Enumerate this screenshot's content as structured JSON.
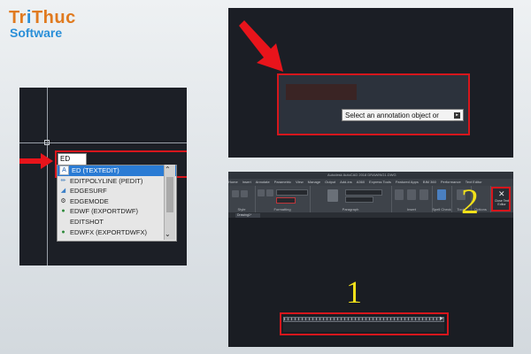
{
  "logo": {
    "line1a": "Tr",
    "line1b": "i",
    "line1c": "Thuc",
    "line2": "Software"
  },
  "panel1": {
    "command_input": "ED",
    "suggestions": [
      {
        "label": "ED (TEXTEDIT)",
        "icon": "text-edit-icon",
        "selected": true
      },
      {
        "label": "EDITPOLYLINE (PEDIT)",
        "icon": "polyline-icon",
        "selected": false
      },
      {
        "label": "EDGESURF",
        "icon": "edge-surface-icon",
        "selected": false
      },
      {
        "label": "EDGEMODE",
        "icon": "gear-icon",
        "selected": false
      },
      {
        "label": "EDWF (EXPORTDWF)",
        "icon": "globe-icon",
        "selected": false
      },
      {
        "label": "EDITSHOT",
        "icon": "",
        "selected": false
      },
      {
        "label": "EDWFX (EXPORTDWFX)",
        "icon": "globe-icon",
        "selected": false
      }
    ]
  },
  "panel2": {
    "tooltip": "Select an annotation object or"
  },
  "panel3": {
    "title": "Autodesk AutoCAD 2018   DRAWING1.DWG",
    "menu": [
      "Home",
      "Insert",
      "Annotate",
      "Parametric",
      "View",
      "Manage",
      "Output",
      "Add-ins",
      "A360",
      "Express Tools",
      "Featured Apps",
      "BIM 360",
      "Performance",
      "Text Editor"
    ],
    "group_labels": [
      "Style",
      "Formatting",
      "Paragraph",
      "Insert",
      "Spell Check",
      "Tools",
      "Options"
    ],
    "close_label": "Close Text Editor",
    "doc_tab": "Drawing1*",
    "marker_1": "1",
    "marker_2": "2"
  },
  "colors": {
    "highlight_red": "#d6161c",
    "marker_yellow": "#f2e01a",
    "logo_orange": "#e07a1f",
    "logo_blue": "#2a8fd8"
  }
}
